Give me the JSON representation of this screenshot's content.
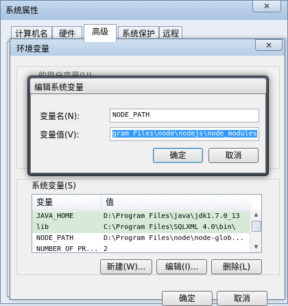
{
  "outer": {
    "title": "系统属性",
    "close_glyph": "✕",
    "tabs": [
      "计算机名",
      "硬件",
      "高级",
      "系统保护",
      "远程"
    ],
    "ok_label": "确定",
    "cancel_label": "取消"
  },
  "env_window": {
    "title": "环境变量",
    "close_glyph": "✕",
    "user_vars_label": "…的用户变量(U)",
    "system_vars_label": "系统变量(S)",
    "columns": [
      "变量",
      "值"
    ],
    "rows": [
      {
        "name": "JAVA_HOME",
        "value": "D:\\Program Files\\java\\jdk1.7.0_13",
        "selected": true
      },
      {
        "name": "lib",
        "value": "C:\\Program Files\\SQLXML 4.0\\bin\\",
        "selected": true
      },
      {
        "name": "NODE_PATH",
        "value": "D:\\Program Files\\node\\node-glob...",
        "selected": false
      },
      {
        "name": "NUMBER_OF_PR...",
        "value": "2",
        "selected": false
      }
    ],
    "buttons": {
      "new": "新建(W)...",
      "edit": "编辑(I)...",
      "delete": "删除(L)"
    }
  },
  "edit_dialog": {
    "title": "编辑系统变量",
    "name_label": "变量名(N):",
    "name_value": "NODE_PATH",
    "value_label": "变量值(V):",
    "value_value": "gram Files\\node\\nodejs\\node_modules",
    "ok_label": "确定",
    "cancel_label": "取消"
  }
}
